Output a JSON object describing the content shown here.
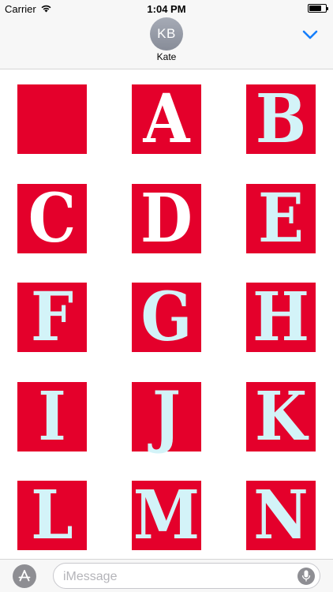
{
  "status_bar": {
    "carrier": "Carrier",
    "time": "1:04 PM",
    "wifi_icon": "wifi-icon",
    "battery_icon": "battery-icon"
  },
  "header": {
    "avatar_initials": "KB",
    "contact_name": "Kate",
    "collapse_icon": "chevron-down-icon",
    "accent_color": "#157efb"
  },
  "stickers": [
    {
      "letter": "",
      "style": "white"
    },
    {
      "letter": "A",
      "style": "white"
    },
    {
      "letter": "B",
      "style": "blue"
    },
    {
      "letter": "C",
      "style": "white"
    },
    {
      "letter": "D",
      "style": "white"
    },
    {
      "letter": "E",
      "style": "blue"
    },
    {
      "letter": "F",
      "style": "blue"
    },
    {
      "letter": "G",
      "style": "blue"
    },
    {
      "letter": "H",
      "style": "blue"
    },
    {
      "letter": "I",
      "style": "blue"
    },
    {
      "letter": "J",
      "style": "blue"
    },
    {
      "letter": "K",
      "style": "blue"
    },
    {
      "letter": "L",
      "style": "blue"
    },
    {
      "letter": "M",
      "style": "blue"
    },
    {
      "letter": "N",
      "style": "blue"
    }
  ],
  "colors": {
    "tile_red": "#e4002b",
    "letter_white": "#ffffff",
    "letter_light_blue": "#d3f3f8"
  },
  "input_bar": {
    "apps_icon": "app-store-icon",
    "placeholder": "iMessage",
    "mic_icon": "microphone-icon"
  }
}
